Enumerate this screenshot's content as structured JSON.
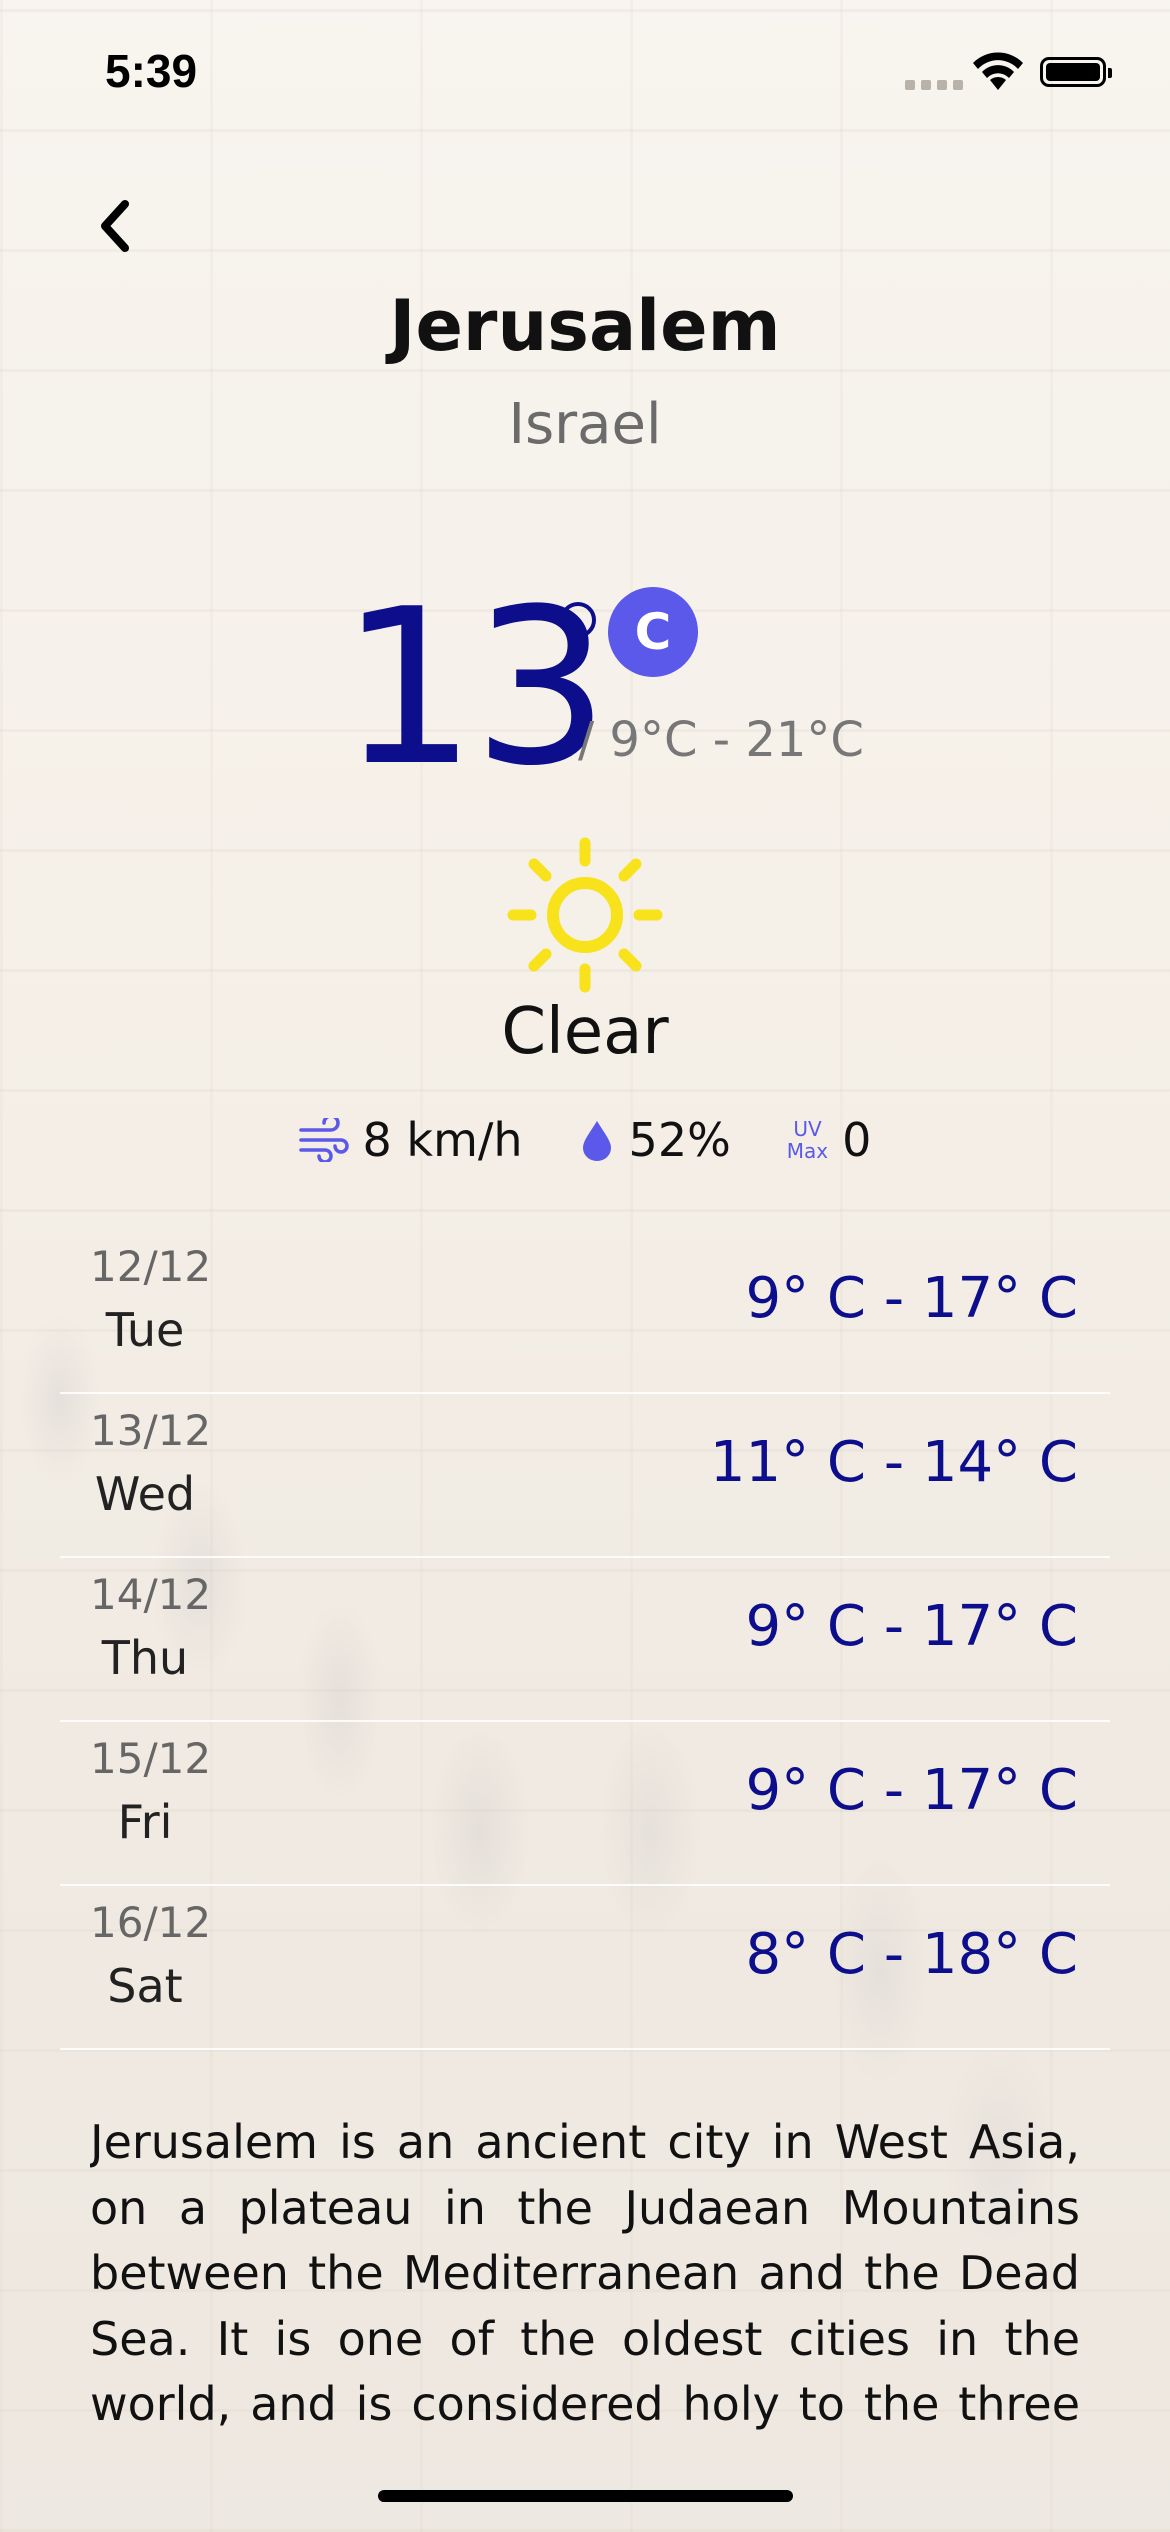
{
  "status_bar": {
    "time": "5:39"
  },
  "header": {
    "city": "Jerusalem",
    "country": "Israel"
  },
  "current": {
    "temperature": "13",
    "unit_toggle": "C",
    "range": "/ 9°C - 21°C",
    "condition": "Clear",
    "icon": "sun-icon"
  },
  "metrics": {
    "wind": "8 km/h",
    "humidity": "52%",
    "uv_label_top": "UV",
    "uv_label_bottom": "Max",
    "uv_value": "0"
  },
  "forecast": [
    {
      "date": "12/12",
      "day": "Tue",
      "range": "9° C - 17° C"
    },
    {
      "date": "13/12",
      "day": "Wed",
      "range": "11° C - 14° C"
    },
    {
      "date": "14/12",
      "day": "Thu",
      "range": "9° C - 17° C"
    },
    {
      "date": "15/12",
      "day": "Fri",
      "range": "9° C - 17° C"
    },
    {
      "date": "16/12",
      "day": "Sat",
      "range": "8° C - 18° C"
    }
  ],
  "description": "Jerusalem is an ancient city in West Asia, on a plateau in the Judaean Mountains between the Mediterranean and the Dead Sea. It is one of the oldest cities in the world, and is considered holy to the three major Abrahamic",
  "colors": {
    "accent": "#5b59ea",
    "temperature": "#0d0e8c",
    "sun": "#f7e21c"
  }
}
